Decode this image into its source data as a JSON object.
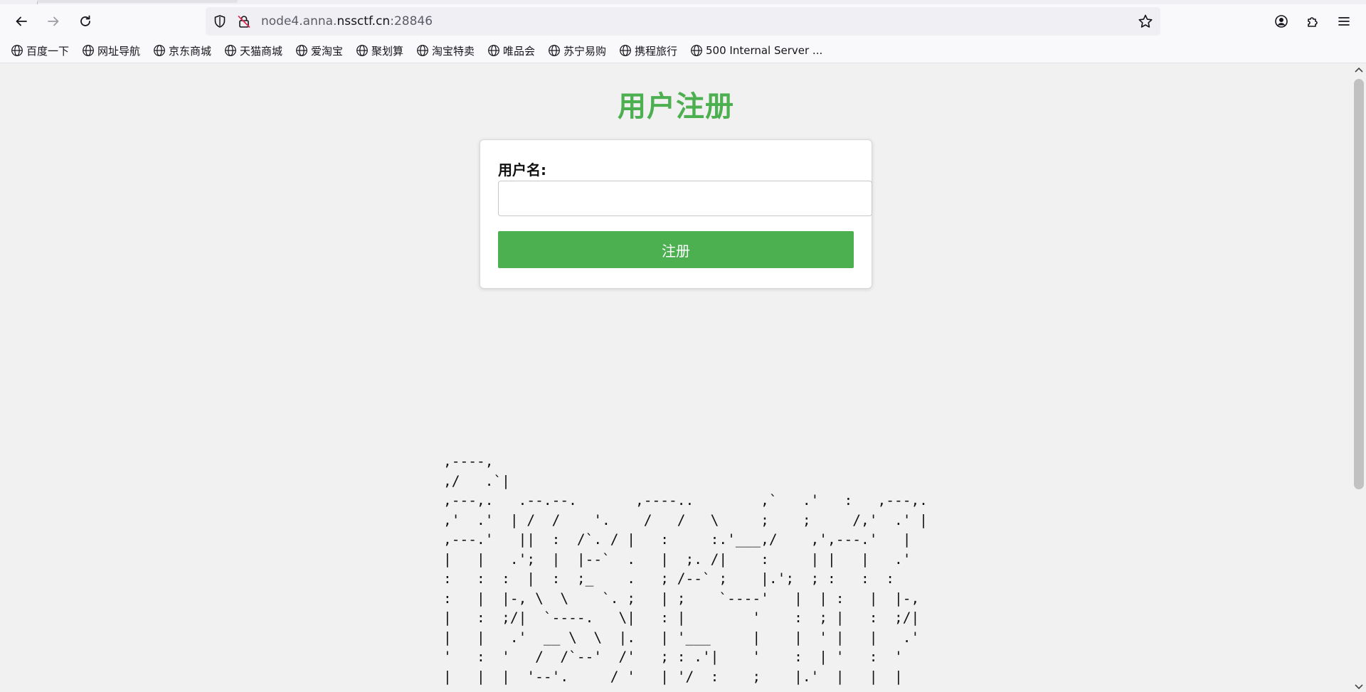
{
  "browser": {
    "url_prefix": "node4.anna.",
    "url_host": "nssctf.cn",
    "url_suffix": ":28846"
  },
  "bookmarks": [
    {
      "label": "百度一下"
    },
    {
      "label": "网址导航"
    },
    {
      "label": "京东商城"
    },
    {
      "label": "天猫商城"
    },
    {
      "label": "爱淘宝"
    },
    {
      "label": "聚划算"
    },
    {
      "label": "淘宝特卖"
    },
    {
      "label": "唯品会"
    },
    {
      "label": "苏宁易购"
    },
    {
      "label": "携程旅行"
    },
    {
      "label": "500 Internal Server ..."
    }
  ],
  "page": {
    "title": "用户注册",
    "username_label": "用户名:",
    "username_value": "",
    "submit_label": "注册",
    "ascii_art": ",----,\n,/   .`|\n,---,.   .--.--.       ,----..        ,`   .'   :   ,---,.\n,'  .'  | /  /    '.    /   /   \\     ;    ;     /,'  .' |\n,---.'   ||  :  /`. / |   :     :.'___,/    ,',---.'   |\n|   |   .';  |  |--`  .   |  ;. /|    :     | |   |   .'\n:   :  :  |  :  ;_    .   ; /--` ;    |.';  ; :   :  :\n:   |  |-, \\  \\    `. ;   | ;    `----'   |  | :   |  |-,\n|   :  ;/|  `----.   \\|   : |        '    :  ; |   :  ;/|\n|   |   .'  __ \\  \\  |.   | '___     |    |  ' |   |   .'\n'   :  '   /  /`--'  /'   ; : .'|    '    :  | '   :  '\n|   |  |  '--'.     / '   | '/  :    ;    |.'  |   |  |"
  }
}
